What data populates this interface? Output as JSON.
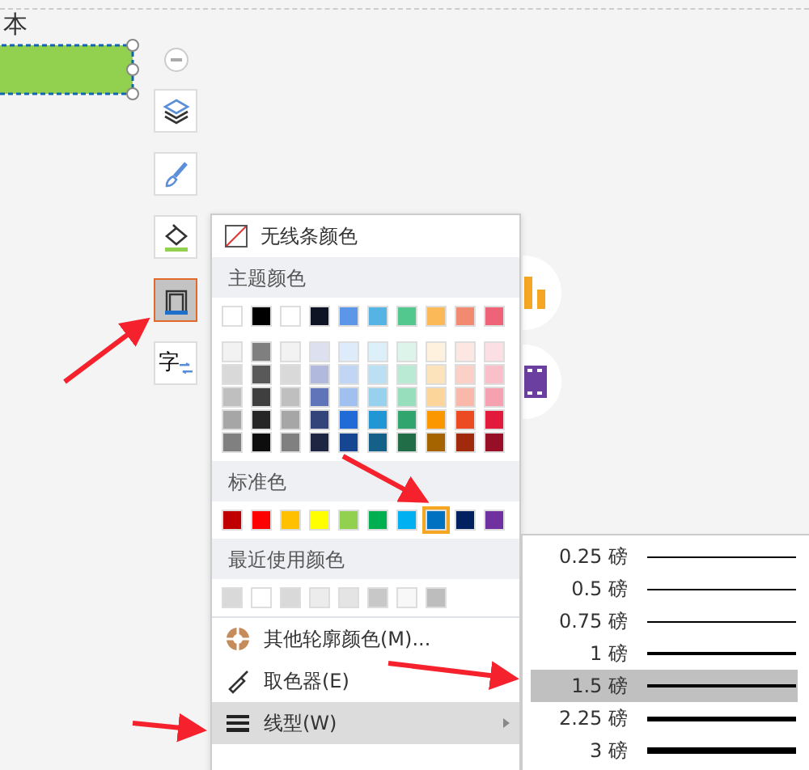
{
  "canvas": {
    "partial_text": "本"
  },
  "toolbar": [
    {
      "kind": "layers",
      "selected": false
    },
    {
      "kind": "brush",
      "selected": false
    },
    {
      "kind": "fill",
      "selected": false
    },
    {
      "kind": "outline",
      "selected": true
    },
    {
      "kind": "text",
      "label": "字",
      "selected": false
    }
  ],
  "color_menu": {
    "no_line": "无线条颜色",
    "theme_header": "主题颜色",
    "theme_colors": [
      {
        "color": "#ffffff"
      },
      {
        "color": "#000000"
      },
      {
        "color": "#ffffff"
      },
      {
        "color": "#0e1423"
      },
      {
        "color": "#5b96e9"
      },
      {
        "color": "#55b4e3"
      },
      {
        "color": "#52c88f"
      },
      {
        "color": "#fbb957"
      },
      {
        "color": "#f28a72"
      },
      {
        "color": "#ef6378"
      }
    ],
    "theme_shades": [
      [
        {
          "color": "#f2f2f2"
        },
        {
          "color": "#7f7f7f"
        },
        {
          "color": "#f2f2f2"
        },
        {
          "color": "#dde1ef"
        },
        {
          "color": "#deebfb"
        },
        {
          "color": "#ddeff9"
        },
        {
          "color": "#dcf4e9"
        },
        {
          "color": "#fef1dd"
        },
        {
          "color": "#fde7e3"
        },
        {
          "color": "#fcdfe4"
        }
      ],
      [
        {
          "color": "#d9d9d9"
        },
        {
          "color": "#595959"
        },
        {
          "color": "#d9d9d9"
        },
        {
          "color": "#b1b9dd"
        },
        {
          "color": "#c1d6f5"
        },
        {
          "color": "#bbe0f4"
        },
        {
          "color": "#baead3"
        },
        {
          "color": "#fde3bc"
        },
        {
          "color": "#fbd0c7"
        },
        {
          "color": "#f9c0ca"
        }
      ],
      [
        {
          "color": "#bfbfbf"
        },
        {
          "color": "#3f3f3f"
        },
        {
          "color": "#bfbfbf"
        },
        {
          "color": "#6075b9"
        },
        {
          "color": "#a0c0ef"
        },
        {
          "color": "#98d1ee"
        },
        {
          "color": "#97dfbc"
        },
        {
          "color": "#fcd59a"
        },
        {
          "color": "#f9b8aa"
        },
        {
          "color": "#f5a1b0"
        }
      ],
      [
        {
          "color": "#a6a6a6"
        },
        {
          "color": "#262626"
        },
        {
          "color": "#a6a6a6"
        },
        {
          "color": "#33447a"
        },
        {
          "color": "#206bd6"
        },
        {
          "color": "#2196d4"
        },
        {
          "color": "#30a56e"
        },
        {
          "color": "#fb9701"
        },
        {
          "color": "#ec4a22"
        },
        {
          "color": "#e21a3b"
        }
      ],
      [
        {
          "color": "#808080"
        },
        {
          "color": "#0d0d0d"
        },
        {
          "color": "#808080"
        },
        {
          "color": "#1d2542"
        },
        {
          "color": "#164591"
        },
        {
          "color": "#146088"
        },
        {
          "color": "#206d48"
        },
        {
          "color": "#a66400"
        },
        {
          "color": "#a1290c"
        },
        {
          "color": "#960f26"
        }
      ]
    ],
    "standard_header": "标准色",
    "standard_colors": [
      {
        "color": "#c00000",
        "selected": false
      },
      {
        "color": "#ff0000",
        "selected": false
      },
      {
        "color": "#ffc000",
        "selected": false
      },
      {
        "color": "#ffff00",
        "selected": false
      },
      {
        "color": "#92d050",
        "selected": false
      },
      {
        "color": "#00b050",
        "selected": false
      },
      {
        "color": "#00b0f0",
        "selected": false
      },
      {
        "color": "#0070c0",
        "selected": true
      },
      {
        "color": "#002060",
        "selected": false
      },
      {
        "color": "#7030a0",
        "selected": false
      }
    ],
    "recent_header": "最近使用颜色",
    "recent_colors": [
      {
        "color": "#d9d9d9"
      },
      {
        "color": "#ffffff"
      },
      {
        "color": "#d9d9d9"
      },
      {
        "color": "#ececec"
      },
      {
        "color": "#e4e4e4"
      },
      {
        "color": "#c8c8c8"
      },
      {
        "color": "#f8f8f8"
      },
      {
        "color": "#bdbdbd"
      }
    ],
    "items": [
      {
        "kind": "more-colors",
        "label": "其他轮廓颜色(M)...",
        "selected": false
      },
      {
        "kind": "eyedropper",
        "label": "取色器(E)",
        "selected": false
      },
      {
        "kind": "line-style",
        "label": "线型(W)",
        "selected": true,
        "submenu": true
      }
    ]
  },
  "weight_menu": [
    {
      "label": "0.25 磅",
      "kind": "thin",
      "selected": false
    },
    {
      "label": "0.5 磅",
      "kind": "thin",
      "selected": false
    },
    {
      "label": "0.75 磅",
      "kind": "thin",
      "selected": false
    },
    {
      "label": "1 磅",
      "kind": "medium",
      "selected": false
    },
    {
      "label": "1.5 磅",
      "kind": "medium",
      "selected": true
    },
    {
      "label": "2.25 磅",
      "kind": "thick",
      "selected": false
    },
    {
      "label": "3 磅",
      "kind": "heavy",
      "selected": false
    }
  ]
}
